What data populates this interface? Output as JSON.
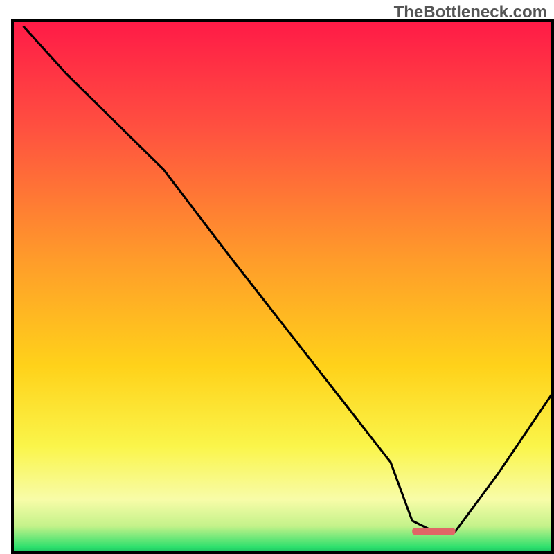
{
  "watermark": "TheBottleneck.com",
  "chart_data": {
    "type": "line",
    "title": "",
    "xlabel": "",
    "ylabel": "",
    "xlim": [
      0,
      100
    ],
    "ylim": [
      0,
      100
    ],
    "description": "Bottleneck curve on rainbow gradient (red top → green bottom). The black line starts top-left, descends steeply, kisses the bottom axis near x≈76 (optimal region marked by a salmon bar), then rises toward the right edge.",
    "series": [
      {
        "name": "bottleneck-curve",
        "x": [
          2,
          10,
          20,
          28,
          40,
          50,
          60,
          70,
          74,
          78,
          82,
          90,
          100
        ],
        "y": [
          99,
          90,
          80,
          72,
          56,
          43,
          30,
          17,
          6,
          4,
          4,
          15,
          30
        ]
      }
    ],
    "marker": {
      "name": "optimal-region",
      "x_start": 74,
      "x_end": 82,
      "y": 4,
      "color": "#e06666"
    },
    "gradient_stops": [
      {
        "offset": 0,
        "color": "#ff1a47"
      },
      {
        "offset": 20,
        "color": "#ff5040"
      },
      {
        "offset": 45,
        "color": "#ff9c2a"
      },
      {
        "offset": 65,
        "color": "#ffd21a"
      },
      {
        "offset": 80,
        "color": "#faf54a"
      },
      {
        "offset": 90,
        "color": "#f8fca8"
      },
      {
        "offset": 95,
        "color": "#c4f28a"
      },
      {
        "offset": 99,
        "color": "#2de06d"
      },
      {
        "offset": 100,
        "color": "#19c060"
      }
    ]
  }
}
